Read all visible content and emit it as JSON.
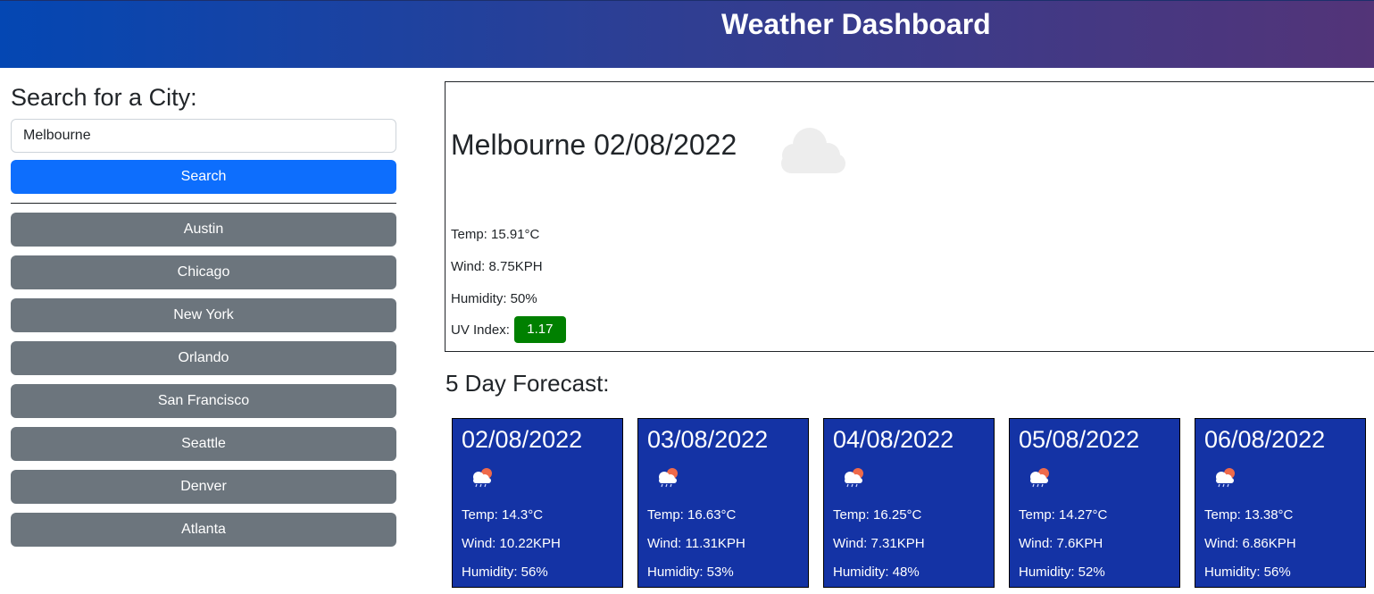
{
  "header": {
    "title": "Weather Dashboard"
  },
  "sidebar": {
    "heading": "Search for a City:",
    "search_value": "Melbourne",
    "search_button": "Search",
    "cities": [
      "Austin",
      "Chicago",
      "New York",
      "Orlando",
      "San Francisco",
      "Seattle",
      "Denver",
      "Atlanta"
    ]
  },
  "current": {
    "title": "Melbourne 02/08/2022",
    "icon": "cloud-icon",
    "temp": "Temp: 15.91°C",
    "wind": "Wind: 8.75KPH",
    "humidity": "Humidity: 50%",
    "uv_label": "UV Index:",
    "uv_value": "1.17",
    "uv_color": "#008000"
  },
  "forecast": {
    "heading": "5 Day Forecast:",
    "icon": "cloud-rain-sun-icon",
    "card_color": "#1433a5",
    "days": [
      {
        "date": "02/08/2022",
        "temp": "Temp: 14.3°C",
        "wind": "Wind: 10.22KPH",
        "humidity": "Humidity: 56%"
      },
      {
        "date": "03/08/2022",
        "temp": "Temp: 16.63°C",
        "wind": "Wind: 11.31KPH",
        "humidity": "Humidity: 53%"
      },
      {
        "date": "04/08/2022",
        "temp": "Temp: 16.25°C",
        "wind": "Wind: 7.31KPH",
        "humidity": "Humidity: 48%"
      },
      {
        "date": "05/08/2022",
        "temp": "Temp: 14.27°C",
        "wind": "Wind: 7.6KPH",
        "humidity": "Humidity: 52%"
      },
      {
        "date": "06/08/2022",
        "temp": "Temp: 13.38°C",
        "wind": "Wind: 6.86KPH",
        "humidity": "Humidity: 56%"
      }
    ]
  }
}
